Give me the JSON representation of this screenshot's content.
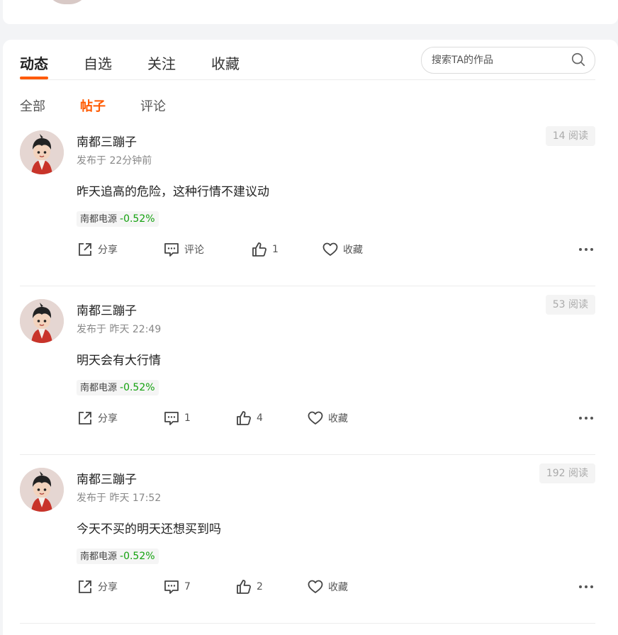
{
  "tabs": [
    {
      "label": "动态",
      "active": true
    },
    {
      "label": "自选",
      "active": false
    },
    {
      "label": "关注",
      "active": false
    },
    {
      "label": "收藏",
      "active": false
    }
  ],
  "search": {
    "placeholder": "搜索TA的作品",
    "icon": "search-icon"
  },
  "subtabs": [
    {
      "label": "全部",
      "active": false
    },
    {
      "label": "帖子",
      "active": true
    },
    {
      "label": "评论",
      "active": false
    }
  ],
  "accent_color": "#ff5a00",
  "down_color": "#13a10e",
  "posts": [
    {
      "author": "南都三蹦子",
      "meta": "发布于 22分钟前",
      "reads": "14 阅读",
      "content": "昨天追高的危险，这种行情不建议动",
      "stock_name": "南都电源",
      "stock_change": "-0.52%",
      "share_label": "分享",
      "comment_label": "评论",
      "like_count": "1",
      "fav_label": "收藏"
    },
    {
      "author": "南都三蹦子",
      "meta": "发布于 昨天 22:49",
      "reads": "53 阅读",
      "content": "明天会有大行情",
      "stock_name": "南都电源",
      "stock_change": "-0.52%",
      "share_label": "分享",
      "comment_label": "1",
      "like_count": "4",
      "fav_label": "收藏"
    },
    {
      "author": "南都三蹦子",
      "meta": "发布于 昨天 17:52",
      "reads": "192 阅读",
      "content": "今天不买的明天还想买到吗",
      "stock_name": "南都电源",
      "stock_change": "-0.52%",
      "share_label": "分享",
      "comment_label": "7",
      "like_count": "2",
      "fav_label": "收藏"
    }
  ]
}
